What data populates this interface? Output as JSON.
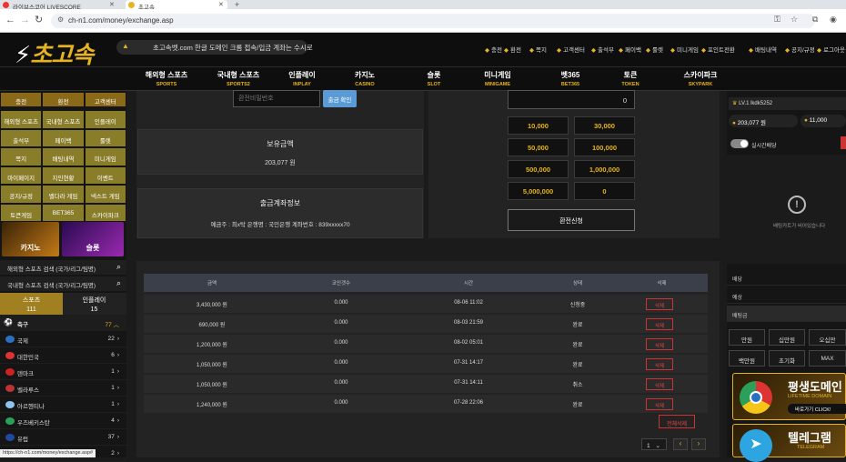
{
  "browser": {
    "tab1_title": "라이브스코어 LIVESCORE",
    "tab2_title": "초고속",
    "url": "ch-n1.com/money/exchange.asp"
  },
  "site": {
    "logo": "초고속",
    "notice": "초고속벳.com 한글 도메인 크롬 접속/입금 계좌는 수시로",
    "top_links": [
      "충전",
      "환전",
      "쪽지",
      "고객센터",
      "출석부",
      "페이백",
      "룰렛",
      "미니게임",
      "포인트전환",
      "배팅내역",
      "공지/규정",
      "로그아웃"
    ],
    "gnb": [
      {
        "ko": "해외형 스포츠",
        "en": "SPORTS"
      },
      {
        "ko": "국내형 스포츠",
        "en": "SPORTS2"
      },
      {
        "ko": "인플레이",
        "en": "INPLAY"
      },
      {
        "ko": "카지노",
        "en": "CASINO"
      },
      {
        "ko": "슬롯",
        "en": "SLOT"
      },
      {
        "ko": "미니게임",
        "en": "MINIGAME"
      },
      {
        "ko": "벳365",
        "en": "BET365"
      },
      {
        "ko": "토큰",
        "en": "TOKEN"
      },
      {
        "ko": "스카이파크",
        "en": "SKYPARK"
      }
    ]
  },
  "left": {
    "top_buttons": [
      "충전",
      "환전",
      "고객센터"
    ],
    "grid": [
      "해외형 스포츠",
      "국내형 스포츠",
      "인플레이",
      "출석부",
      "페이백",
      "룰렛",
      "쪽지",
      "배팅내역",
      "미니게임",
      "마이페이지",
      "지인현황",
      "이벤트",
      "공지/규정",
      "벨다라 게임",
      "넥스트 게임",
      "토큰게임",
      "BET365",
      "스카이파크"
    ],
    "banner1": "카지노",
    "banner2": "슬롯",
    "search1": "해외형 스포츠 검색 (국가/리그/팀명)",
    "search2": "국내형 스포츠 검색 (국가/리그/팀명)",
    "tab1": {
      "label": "스포츠",
      "count": "111"
    },
    "tab2": {
      "label": "인플레이",
      "count": "15"
    },
    "sport": {
      "name": "축구",
      "count": "77"
    },
    "leagues": [
      {
        "name": "국제",
        "count": "22",
        "color": "#2a6fc0"
      },
      {
        "name": "대한민국",
        "count": "6",
        "color": "#d33"
      },
      {
        "name": "덴마크",
        "count": "1",
        "color": "#c22"
      },
      {
        "name": "벨라루스",
        "count": "1",
        "color": "#b33"
      },
      {
        "name": "아르헨티나",
        "count": "1",
        "color": "#8cc4ef"
      },
      {
        "name": "우즈베키스탄",
        "count": "4",
        "color": "#2aa05a"
      },
      {
        "name": "유럽",
        "count": "37",
        "color": "#1f4aa0"
      },
      {
        "name": "",
        "count": "2",
        "color": "#888"
      }
    ]
  },
  "exchange": {
    "pw_placeholder": "환전비밀번호",
    "pw_button": "출금 확인",
    "holding_title": "보유금액",
    "holding_value": "203,077 원",
    "account_title": "출금계좌정보",
    "account_info": "예금주 : 최x탁 은행명 : 국민은행 계좌번호 : 839xxxxx70",
    "amount_input": "0",
    "amounts": [
      "10,000",
      "30,000",
      "50,000",
      "100,000",
      "500,000",
      "1,000,000",
      "5,000,000",
      "0"
    ],
    "submit": "환전신청"
  },
  "history": {
    "headers": [
      "금액",
      "코인갯수",
      "시간",
      "상태",
      "삭제"
    ],
    "rows": [
      {
        "amount": "3,430,000 원",
        "coins": "0.000",
        "time": "08-06 11:02",
        "status": "신청중",
        "del": "삭제"
      },
      {
        "amount": "690,000 원",
        "coins": "0.000",
        "time": "08-03 21:59",
        "status": "완료",
        "del": "삭제"
      },
      {
        "amount": "1,200,000 원",
        "coins": "0.000",
        "time": "08-02 05:01",
        "status": "완료",
        "del": "삭제"
      },
      {
        "amount": "1,050,000 원",
        "coins": "0.000",
        "time": "07-31 14:17",
        "status": "완료",
        "del": "삭제"
      },
      {
        "amount": "1,050,000 원",
        "coins": "0.000",
        "time": "07-31 14:11",
        "status": "취소",
        "del": "삭제"
      },
      {
        "amount": "1,240,000 원",
        "coins": "0.000",
        "time": "07-28 22:06",
        "status": "완료",
        "del": "삭제"
      }
    ],
    "delete_all": "전체삭제",
    "page": "1"
  },
  "right": {
    "level": "LV.1",
    "user": "lkdk5252",
    "money": "203,077 원",
    "point": "11,000",
    "live_toggle": "실시간배당",
    "empty_msg": "배팅카트가 비어있습니다",
    "labels": [
      "배당",
      "예상",
      "배팅금"
    ],
    "chips": [
      "만원",
      "십만원",
      "오십만",
      "백만원",
      "초기화",
      "MAX"
    ],
    "promo1_main": "평생도메인",
    "promo1_sub": "LIFETIME DOMAIN",
    "promo1_btn": "바로가기 CLICK!",
    "promo2_main": "텔레그램",
    "promo2_sub": "TELEGRAM"
  },
  "status_url": "https://ch-n1.com/money/exchange.asp#"
}
